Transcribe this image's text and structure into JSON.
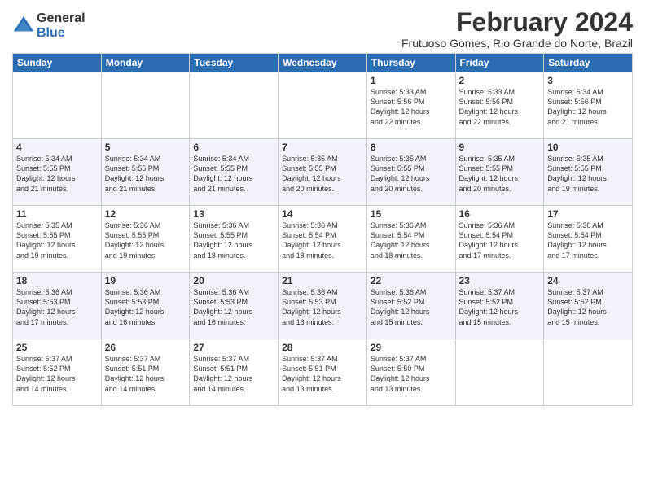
{
  "logo": {
    "general": "General",
    "blue": "Blue"
  },
  "title": {
    "month_year": "February 2024",
    "location": "Frutuoso Gomes, Rio Grande do Norte, Brazil"
  },
  "days_of_week": [
    "Sunday",
    "Monday",
    "Tuesday",
    "Wednesday",
    "Thursday",
    "Friday",
    "Saturday"
  ],
  "weeks": [
    [
      {
        "day": "",
        "info": ""
      },
      {
        "day": "",
        "info": ""
      },
      {
        "day": "",
        "info": ""
      },
      {
        "day": "",
        "info": ""
      },
      {
        "day": "1",
        "info": "Sunrise: 5:33 AM\nSunset: 5:56 PM\nDaylight: 12 hours\nand 22 minutes."
      },
      {
        "day": "2",
        "info": "Sunrise: 5:33 AM\nSunset: 5:56 PM\nDaylight: 12 hours\nand 22 minutes."
      },
      {
        "day": "3",
        "info": "Sunrise: 5:34 AM\nSunset: 5:56 PM\nDaylight: 12 hours\nand 21 minutes."
      }
    ],
    [
      {
        "day": "4",
        "info": "Sunrise: 5:34 AM\nSunset: 5:55 PM\nDaylight: 12 hours\nand 21 minutes."
      },
      {
        "day": "5",
        "info": "Sunrise: 5:34 AM\nSunset: 5:55 PM\nDaylight: 12 hours\nand 21 minutes."
      },
      {
        "day": "6",
        "info": "Sunrise: 5:34 AM\nSunset: 5:55 PM\nDaylight: 12 hours\nand 21 minutes."
      },
      {
        "day": "7",
        "info": "Sunrise: 5:35 AM\nSunset: 5:55 PM\nDaylight: 12 hours\nand 20 minutes."
      },
      {
        "day": "8",
        "info": "Sunrise: 5:35 AM\nSunset: 5:55 PM\nDaylight: 12 hours\nand 20 minutes."
      },
      {
        "day": "9",
        "info": "Sunrise: 5:35 AM\nSunset: 5:55 PM\nDaylight: 12 hours\nand 20 minutes."
      },
      {
        "day": "10",
        "info": "Sunrise: 5:35 AM\nSunset: 5:55 PM\nDaylight: 12 hours\nand 19 minutes."
      }
    ],
    [
      {
        "day": "11",
        "info": "Sunrise: 5:35 AM\nSunset: 5:55 PM\nDaylight: 12 hours\nand 19 minutes."
      },
      {
        "day": "12",
        "info": "Sunrise: 5:36 AM\nSunset: 5:55 PM\nDaylight: 12 hours\nand 19 minutes."
      },
      {
        "day": "13",
        "info": "Sunrise: 5:36 AM\nSunset: 5:55 PM\nDaylight: 12 hours\nand 18 minutes."
      },
      {
        "day": "14",
        "info": "Sunrise: 5:36 AM\nSunset: 5:54 PM\nDaylight: 12 hours\nand 18 minutes."
      },
      {
        "day": "15",
        "info": "Sunrise: 5:36 AM\nSunset: 5:54 PM\nDaylight: 12 hours\nand 18 minutes."
      },
      {
        "day": "16",
        "info": "Sunrise: 5:36 AM\nSunset: 5:54 PM\nDaylight: 12 hours\nand 17 minutes."
      },
      {
        "day": "17",
        "info": "Sunrise: 5:36 AM\nSunset: 5:54 PM\nDaylight: 12 hours\nand 17 minutes."
      }
    ],
    [
      {
        "day": "18",
        "info": "Sunrise: 5:36 AM\nSunset: 5:53 PM\nDaylight: 12 hours\nand 17 minutes."
      },
      {
        "day": "19",
        "info": "Sunrise: 5:36 AM\nSunset: 5:53 PM\nDaylight: 12 hours\nand 16 minutes."
      },
      {
        "day": "20",
        "info": "Sunrise: 5:36 AM\nSunset: 5:53 PM\nDaylight: 12 hours\nand 16 minutes."
      },
      {
        "day": "21",
        "info": "Sunrise: 5:36 AM\nSunset: 5:53 PM\nDaylight: 12 hours\nand 16 minutes."
      },
      {
        "day": "22",
        "info": "Sunrise: 5:36 AM\nSunset: 5:52 PM\nDaylight: 12 hours\nand 15 minutes."
      },
      {
        "day": "23",
        "info": "Sunrise: 5:37 AM\nSunset: 5:52 PM\nDaylight: 12 hours\nand 15 minutes."
      },
      {
        "day": "24",
        "info": "Sunrise: 5:37 AM\nSunset: 5:52 PM\nDaylight: 12 hours\nand 15 minutes."
      }
    ],
    [
      {
        "day": "25",
        "info": "Sunrise: 5:37 AM\nSunset: 5:52 PM\nDaylight: 12 hours\nand 14 minutes."
      },
      {
        "day": "26",
        "info": "Sunrise: 5:37 AM\nSunset: 5:51 PM\nDaylight: 12 hours\nand 14 minutes."
      },
      {
        "day": "27",
        "info": "Sunrise: 5:37 AM\nSunset: 5:51 PM\nDaylight: 12 hours\nand 14 minutes."
      },
      {
        "day": "28",
        "info": "Sunrise: 5:37 AM\nSunset: 5:51 PM\nDaylight: 12 hours\nand 13 minutes."
      },
      {
        "day": "29",
        "info": "Sunrise: 5:37 AM\nSunset: 5:50 PM\nDaylight: 12 hours\nand 13 minutes."
      },
      {
        "day": "",
        "info": ""
      },
      {
        "day": "",
        "info": ""
      }
    ]
  ]
}
